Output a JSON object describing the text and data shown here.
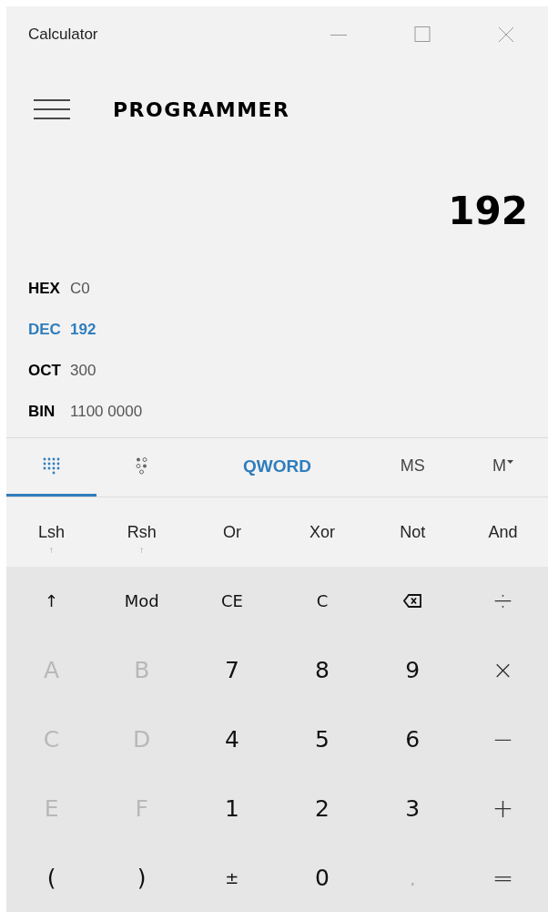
{
  "window": {
    "title": "Calculator"
  },
  "mode": {
    "title": "PROGRAMMER"
  },
  "display": {
    "value": "192"
  },
  "radix": [
    {
      "label": "HEX",
      "value": "C0",
      "selected": false
    },
    {
      "label": "DEC",
      "value": "192",
      "selected": true
    },
    {
      "label": "OCT",
      "value": "300",
      "selected": false
    },
    {
      "label": "BIN",
      "value": "1100 0000",
      "selected": false
    }
  ],
  "tabs": [
    {
      "kind": "keypad",
      "selected": true
    },
    {
      "kind": "bitflip",
      "selected": false
    }
  ],
  "word_size": "QWORD",
  "memory": [
    {
      "label": "MS",
      "kind": "text"
    },
    {
      "label": "M",
      "kind": "dropdown"
    }
  ],
  "bitwise": [
    {
      "label": "Lsh",
      "sub": "↑"
    },
    {
      "label": "Rsh",
      "sub": "↑"
    },
    {
      "label": "Or"
    },
    {
      "label": "Xor"
    },
    {
      "label": "Not"
    },
    {
      "label": "And"
    }
  ],
  "keys": [
    {
      "kind": "text",
      "label": "↑",
      "disabled": false
    },
    {
      "kind": "text",
      "label": "Mod",
      "disabled": false
    },
    {
      "kind": "text",
      "label": "CE",
      "disabled": false
    },
    {
      "kind": "text",
      "label": "C",
      "disabled": false
    },
    {
      "kind": "backspace",
      "disabled": false
    },
    {
      "kind": "operator",
      "label": "÷",
      "disabled": false
    },
    {
      "kind": "digit",
      "label": "A",
      "disabled": true
    },
    {
      "kind": "digit",
      "label": "B",
      "disabled": true
    },
    {
      "kind": "digit",
      "label": "7",
      "disabled": false
    },
    {
      "kind": "digit",
      "label": "8",
      "disabled": false
    },
    {
      "kind": "digit",
      "label": "9",
      "disabled": false
    },
    {
      "kind": "operator",
      "label": "×",
      "disabled": false
    },
    {
      "kind": "digit",
      "label": "C",
      "disabled": true
    },
    {
      "kind": "digit",
      "label": "D",
      "disabled": true
    },
    {
      "kind": "digit",
      "label": "4",
      "disabled": false
    },
    {
      "kind": "digit",
      "label": "5",
      "disabled": false
    },
    {
      "kind": "digit",
      "label": "6",
      "disabled": false
    },
    {
      "kind": "operator",
      "label": "−",
      "disabled": false
    },
    {
      "kind": "digit",
      "label": "E",
      "disabled": true
    },
    {
      "kind": "digit",
      "label": "F",
      "disabled": true
    },
    {
      "kind": "digit",
      "label": "1",
      "disabled": false
    },
    {
      "kind": "digit",
      "label": "2",
      "disabled": false
    },
    {
      "kind": "digit",
      "label": "3",
      "disabled": false
    },
    {
      "kind": "operator",
      "label": "+",
      "disabled": false
    },
    {
      "kind": "digit",
      "label": "(",
      "disabled": false
    },
    {
      "kind": "digit",
      "label": ")",
      "disabled": false
    },
    {
      "kind": "text",
      "label": "±",
      "disabled": false
    },
    {
      "kind": "digit",
      "label": "0",
      "disabled": false
    },
    {
      "kind": "digit",
      "label": ".",
      "disabled": true
    },
    {
      "kind": "operator",
      "label": "=",
      "disabled": false
    }
  ]
}
